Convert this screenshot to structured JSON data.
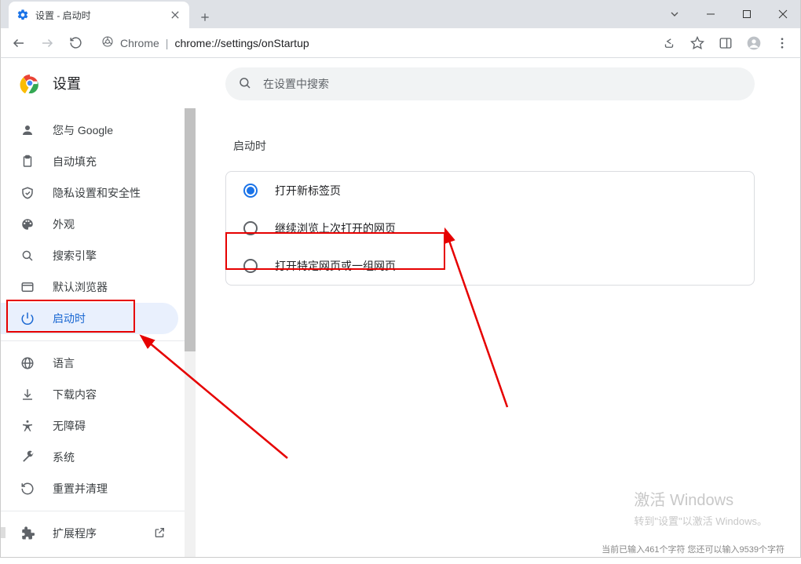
{
  "window": {
    "tab_title": "设置 - 启动时"
  },
  "address_bar": {
    "brand": "Chrome",
    "url": "chrome://settings/onStartup"
  },
  "header": {
    "title": "设置",
    "search_placeholder": "在设置中搜索"
  },
  "sidebar": {
    "items": [
      {
        "label": "您与 Google"
      },
      {
        "label": "自动填充"
      },
      {
        "label": "隐私设置和安全性"
      },
      {
        "label": "外观"
      },
      {
        "label": "搜索引擎"
      },
      {
        "label": "默认浏览器"
      },
      {
        "label": "启动时"
      },
      {
        "label": "语言"
      },
      {
        "label": "下载内容"
      },
      {
        "label": "无障碍"
      },
      {
        "label": "系统"
      },
      {
        "label": "重置并清理"
      },
      {
        "label": "扩展程序"
      }
    ]
  },
  "main": {
    "section_title": "启动时",
    "options": [
      {
        "label": "打开新标签页",
        "selected": true
      },
      {
        "label": "继续浏览上次打开的网页",
        "selected": false
      },
      {
        "label": "打开特定网页或一组网页",
        "selected": false
      }
    ]
  },
  "watermark": {
    "title": "激活 Windows",
    "sub": "转到\"设置\"以激活 Windows。"
  },
  "fragment": "当前已输入461个字符 您还可以输入9539个字符"
}
